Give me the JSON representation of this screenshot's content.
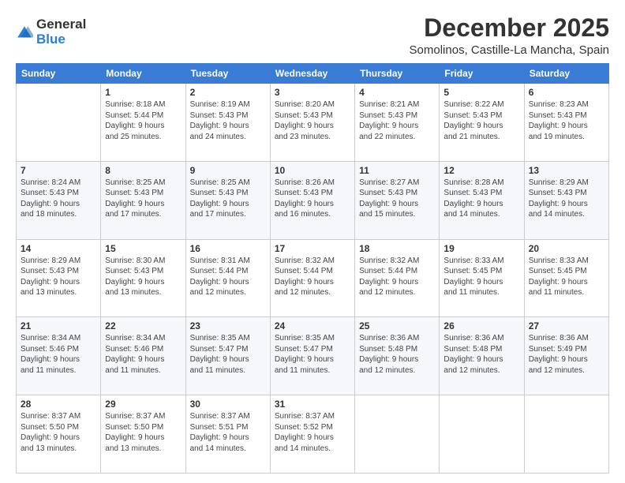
{
  "logo": {
    "general": "General",
    "blue": "Blue"
  },
  "title": "December 2025",
  "location": "Somolinos, Castille-La Mancha, Spain",
  "weekdays": [
    "Sunday",
    "Monday",
    "Tuesday",
    "Wednesday",
    "Thursday",
    "Friday",
    "Saturday"
  ],
  "weeks": [
    [
      {
        "day": "",
        "info": ""
      },
      {
        "day": "1",
        "info": "Sunrise: 8:18 AM\nSunset: 5:44 PM\nDaylight: 9 hours\nand 25 minutes."
      },
      {
        "day": "2",
        "info": "Sunrise: 8:19 AM\nSunset: 5:43 PM\nDaylight: 9 hours\nand 24 minutes."
      },
      {
        "day": "3",
        "info": "Sunrise: 8:20 AM\nSunset: 5:43 PM\nDaylight: 9 hours\nand 23 minutes."
      },
      {
        "day": "4",
        "info": "Sunrise: 8:21 AM\nSunset: 5:43 PM\nDaylight: 9 hours\nand 22 minutes."
      },
      {
        "day": "5",
        "info": "Sunrise: 8:22 AM\nSunset: 5:43 PM\nDaylight: 9 hours\nand 21 minutes."
      },
      {
        "day": "6",
        "info": "Sunrise: 8:23 AM\nSunset: 5:43 PM\nDaylight: 9 hours\nand 19 minutes."
      }
    ],
    [
      {
        "day": "7",
        "info": "Sunrise: 8:24 AM\nSunset: 5:43 PM\nDaylight: 9 hours\nand 18 minutes."
      },
      {
        "day": "8",
        "info": "Sunrise: 8:25 AM\nSunset: 5:43 PM\nDaylight: 9 hours\nand 17 minutes."
      },
      {
        "day": "9",
        "info": "Sunrise: 8:25 AM\nSunset: 5:43 PM\nDaylight: 9 hours\nand 17 minutes."
      },
      {
        "day": "10",
        "info": "Sunrise: 8:26 AM\nSunset: 5:43 PM\nDaylight: 9 hours\nand 16 minutes."
      },
      {
        "day": "11",
        "info": "Sunrise: 8:27 AM\nSunset: 5:43 PM\nDaylight: 9 hours\nand 15 minutes."
      },
      {
        "day": "12",
        "info": "Sunrise: 8:28 AM\nSunset: 5:43 PM\nDaylight: 9 hours\nand 14 minutes."
      },
      {
        "day": "13",
        "info": "Sunrise: 8:29 AM\nSunset: 5:43 PM\nDaylight: 9 hours\nand 14 minutes."
      }
    ],
    [
      {
        "day": "14",
        "info": "Sunrise: 8:29 AM\nSunset: 5:43 PM\nDaylight: 9 hours\nand 13 minutes."
      },
      {
        "day": "15",
        "info": "Sunrise: 8:30 AM\nSunset: 5:43 PM\nDaylight: 9 hours\nand 13 minutes."
      },
      {
        "day": "16",
        "info": "Sunrise: 8:31 AM\nSunset: 5:44 PM\nDaylight: 9 hours\nand 12 minutes."
      },
      {
        "day": "17",
        "info": "Sunrise: 8:32 AM\nSunset: 5:44 PM\nDaylight: 9 hours\nand 12 minutes."
      },
      {
        "day": "18",
        "info": "Sunrise: 8:32 AM\nSunset: 5:44 PM\nDaylight: 9 hours\nand 12 minutes."
      },
      {
        "day": "19",
        "info": "Sunrise: 8:33 AM\nSunset: 5:45 PM\nDaylight: 9 hours\nand 11 minutes."
      },
      {
        "day": "20",
        "info": "Sunrise: 8:33 AM\nSunset: 5:45 PM\nDaylight: 9 hours\nand 11 minutes."
      }
    ],
    [
      {
        "day": "21",
        "info": "Sunrise: 8:34 AM\nSunset: 5:46 PM\nDaylight: 9 hours\nand 11 minutes."
      },
      {
        "day": "22",
        "info": "Sunrise: 8:34 AM\nSunset: 5:46 PM\nDaylight: 9 hours\nand 11 minutes."
      },
      {
        "day": "23",
        "info": "Sunrise: 8:35 AM\nSunset: 5:47 PM\nDaylight: 9 hours\nand 11 minutes."
      },
      {
        "day": "24",
        "info": "Sunrise: 8:35 AM\nSunset: 5:47 PM\nDaylight: 9 hours\nand 11 minutes."
      },
      {
        "day": "25",
        "info": "Sunrise: 8:36 AM\nSunset: 5:48 PM\nDaylight: 9 hours\nand 12 minutes."
      },
      {
        "day": "26",
        "info": "Sunrise: 8:36 AM\nSunset: 5:48 PM\nDaylight: 9 hours\nand 12 minutes."
      },
      {
        "day": "27",
        "info": "Sunrise: 8:36 AM\nSunset: 5:49 PM\nDaylight: 9 hours\nand 12 minutes."
      }
    ],
    [
      {
        "day": "28",
        "info": "Sunrise: 8:37 AM\nSunset: 5:50 PM\nDaylight: 9 hours\nand 13 minutes."
      },
      {
        "day": "29",
        "info": "Sunrise: 8:37 AM\nSunset: 5:50 PM\nDaylight: 9 hours\nand 13 minutes."
      },
      {
        "day": "30",
        "info": "Sunrise: 8:37 AM\nSunset: 5:51 PM\nDaylight: 9 hours\nand 14 minutes."
      },
      {
        "day": "31",
        "info": "Sunrise: 8:37 AM\nSunset: 5:52 PM\nDaylight: 9 hours\nand 14 minutes."
      },
      {
        "day": "",
        "info": ""
      },
      {
        "day": "",
        "info": ""
      },
      {
        "day": "",
        "info": ""
      }
    ]
  ]
}
